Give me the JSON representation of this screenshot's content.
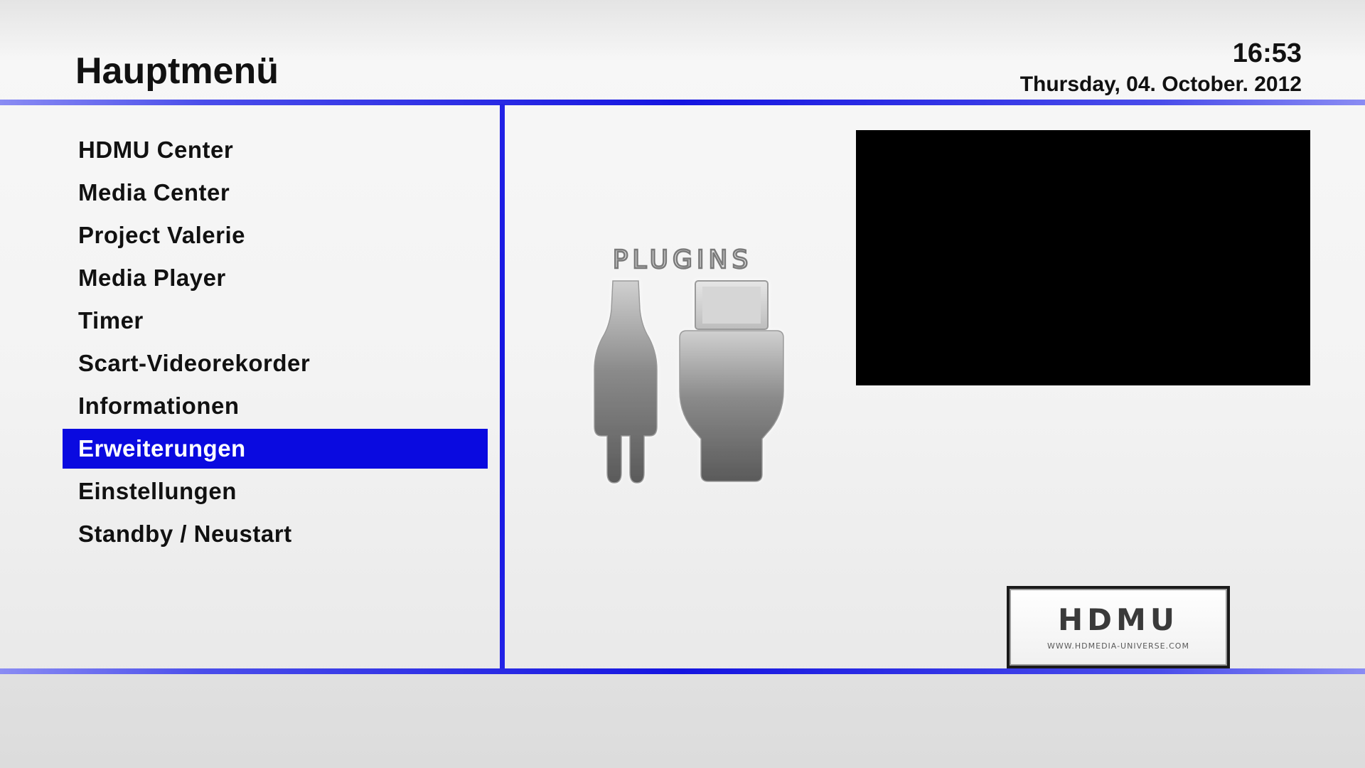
{
  "header": {
    "title": "Hauptmenü",
    "time": "16:53",
    "date": "Thursday, 04. October. 2012"
  },
  "menu": {
    "selected_index": 7,
    "items": [
      "HDMU Center",
      "Media Center",
      "Project Valerie",
      "Media Player",
      "Timer",
      "Scart-Videorekorder",
      "Informationen",
      "Erweiterungen",
      "Einstellungen",
      "Standby / Neustart"
    ]
  },
  "graphic": {
    "label": "PLUGINS",
    "icon": "plugins-icon"
  },
  "logo": {
    "text": "HDMU",
    "url": "WWW.HDMEDIA-UNIVERSE.COM"
  },
  "colors": {
    "accent": "#0a0ae0",
    "background": "#f3f3f3",
    "preview": "#000000"
  }
}
